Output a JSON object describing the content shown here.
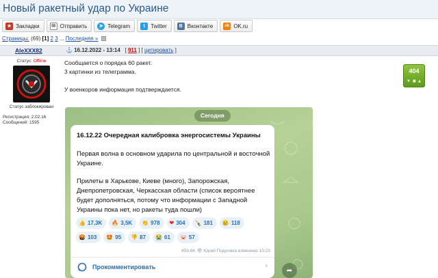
{
  "page": {
    "title": "Новый ракетный удар по Украине"
  },
  "share": {
    "buttons": [
      {
        "label": "Закладки",
        "icon": "bookmark-icon",
        "color": "#c0392b",
        "glyph": "★"
      },
      {
        "label": "Отправить",
        "icon": "mail-icon",
        "color": "#ffffff",
        "glyph": "✉"
      },
      {
        "label": "Telegram",
        "icon": "telegram-icon",
        "color": "#2aa3df",
        "glyph": "➤"
      },
      {
        "label": "Twitter",
        "icon": "twitter-icon",
        "color": "#1da1f2",
        "glyph": "t"
      },
      {
        "label": "Вконтакте",
        "icon": "vk-icon",
        "color": "#4c75a3",
        "glyph": "B"
      },
      {
        "label": "OK.ru",
        "icon": "ok-icon",
        "color": "#ee8208",
        "glyph": "ok"
      }
    ]
  },
  "pagination": {
    "label": "Страницы:",
    "total": "(69)",
    "current": "[1]",
    "page2": "2",
    "page3": "3",
    "ellipsis": "...",
    "last": "Последняя »"
  },
  "post": {
    "author": "AleXXX82",
    "datetime": "16.12.2022 - 13:14",
    "post_number_open": "[",
    "post_number": "911",
    "post_number_close": "]",
    "quote_open": "[",
    "quote_label": "цитировать",
    "quote_close": "]",
    "text_lines": [
      "Сообщается о порядка 60 ракет.",
      "3 картинки из телеграмма.",
      "",
      "У военкоров информация подтверждается."
    ],
    "rating": "404"
  },
  "user": {
    "status_label": "Статус:",
    "status_value": "Offline",
    "blocked": "Статус заблокирован",
    "registration": "Регистрация: 2.02.16",
    "messages": "Сообщений: 1595"
  },
  "telegram": {
    "date_pill": "Сегодня",
    "title": "16.12.22 Очередная калибровка энергосистемы Украины",
    "paragraph1": "Первая волна в основном ударила по центральной и восточной Украине.",
    "paragraph2": "Прилеты в Харькове, Киеве (много), Запорожская, Днепропетровская, Черкасская области (список вероятнее будет дополняться, потому что информации с Западной Украины пока нет, но ракеты туда пошли)",
    "reactions_row1": [
      {
        "emoji": "👍",
        "count": "17,3K"
      },
      {
        "emoji": "🔥",
        "count": "3,5K"
      },
      {
        "emoji": "👏",
        "count": "978"
      },
      {
        "emoji": "❤",
        "count": "304"
      },
      {
        "emoji": "🍾",
        "count": "181"
      },
      {
        "emoji": "😢",
        "count": "118"
      }
    ],
    "reactions_row2": [
      {
        "emoji": "🤬",
        "count": "103"
      },
      {
        "emoji": "🤩",
        "count": "95"
      },
      {
        "emoji": "👎",
        "count": "87"
      },
      {
        "emoji": "😭",
        "count": "61"
      },
      {
        "emoji": "🐷",
        "count": "57"
      }
    ],
    "footer": "459,6K 👁 Юрий Подоляка  изменено 10:23",
    "comment_label": "Прокомментировать"
  }
}
